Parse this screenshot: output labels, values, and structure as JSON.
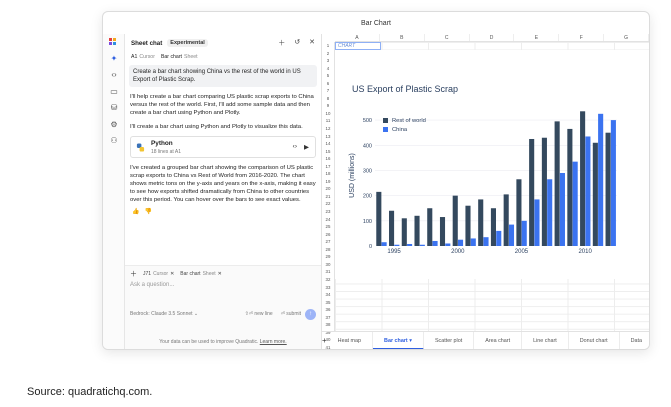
{
  "window": {
    "title": "Bar Chart"
  },
  "caption": "Source: quadratichq.com.",
  "chat": {
    "title": "Sheet chat",
    "badge": "Experimental",
    "context_chips": [
      {
        "name": "A1",
        "kind": "Cursor"
      },
      {
        "name": "Bar chart",
        "kind": "Sheet"
      }
    ],
    "user_message": "Create a bar chart showing China vs the rest of the world in US Export of Plastic Scrap.",
    "response_1": "I'll help create a bar chart comparing US plastic scrap exports to China versus the rest of the world. First, I'll add some sample data and then create a bar chart using Python and Plotly.",
    "response_2": "I'll create a bar chart using Python and Plotly to visualize this data.",
    "code_card": {
      "language": "Python",
      "subtitle": "18 lines at A1"
    },
    "response_3": "I've created a grouped bar chart showing the comparison of US plastic scrap exports to China vs Rest of World from 2016-2020. The chart shows metric tons on the y-axis and years on the x-axis, making it easy to see how exports shifted dramatically from China to other countries over this period. You can hover over the bars to see exact values.",
    "composer": {
      "chips": [
        {
          "name": "J71",
          "kind": "Cursor"
        },
        {
          "name": "Bar chart",
          "kind": "Sheet"
        }
      ],
      "placeholder": "Ask a question...",
      "model": "Bedrock: Claude 3.5 Sonnet",
      "newline_hint": "⇧⏎ new line",
      "submit_hint": "⏎ submit"
    },
    "disclaimer": "Your data can be used to improve Quadratic.",
    "disclaimer_link": "Learn more."
  },
  "sheet": {
    "columns": [
      "A",
      "B",
      "C",
      "D",
      "E",
      "F",
      "G"
    ],
    "rows": [
      "1",
      "2",
      "3",
      "4",
      "5",
      "6",
      "7",
      "8",
      "9",
      "10",
      "11",
      "12",
      "13",
      "14",
      "15",
      "16",
      "17",
      "18",
      "19",
      "20",
      "21",
      "22",
      "23",
      "24",
      "25",
      "26",
      "27",
      "28",
      "29",
      "30",
      "31",
      "32",
      "33",
      "34",
      "35",
      "36",
      "37",
      "38",
      "39",
      "40",
      "41",
      "42"
    ],
    "cell_a1": "CHART",
    "tabs": [
      "Heat map",
      "Bar chart",
      "Scatter plot",
      "Area chart",
      "Line chart",
      "Donut chart",
      "Data"
    ],
    "active_tab": "Bar chart"
  },
  "chart_data": {
    "type": "bar",
    "title": "US Export of Plastic Scrap",
    "xlabel": "",
    "ylabel": "USD (millions)",
    "x": [
      1994,
      1995,
      1996,
      1997,
      1998,
      1999,
      2000,
      2001,
      2002,
      2003,
      2004,
      2005,
      2006,
      2007,
      2008,
      2009,
      2010,
      2011,
      2012
    ],
    "xticks": [
      1995,
      2000,
      2005,
      2010
    ],
    "yticks": [
      0,
      100,
      200,
      300,
      400,
      500
    ],
    "ylim": [
      0,
      560
    ],
    "xlim": [
      1993.5,
      2012.5
    ],
    "legend": "top-left",
    "series": [
      {
        "name": "Rest of world",
        "color": "#34495e",
        "values": [
          215,
          140,
          110,
          120,
          150,
          115,
          200,
          160,
          185,
          150,
          205,
          265,
          425,
          430,
          495,
          465,
          535,
          410,
          450
        ]
      },
      {
        "name": "China",
        "color": "#3b73f0",
        "values": [
          15,
          5,
          8,
          5,
          20,
          10,
          25,
          30,
          35,
          60,
          85,
          100,
          185,
          265,
          290,
          335,
          435,
          525,
          500
        ]
      }
    ]
  }
}
